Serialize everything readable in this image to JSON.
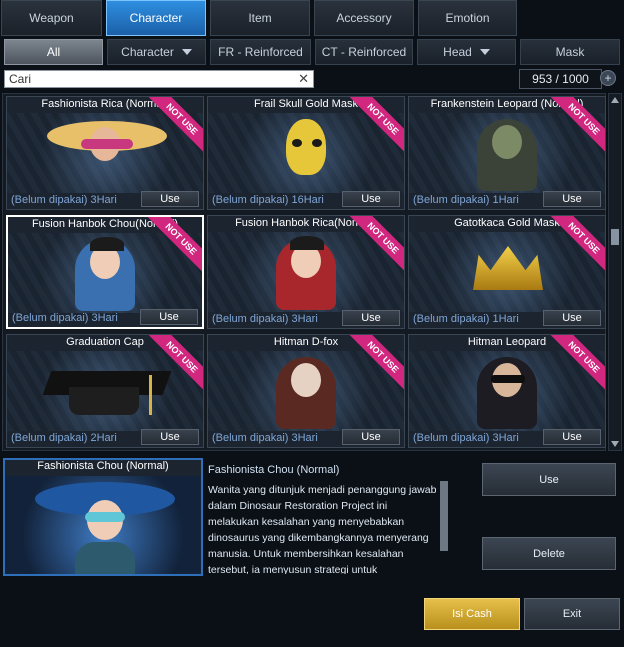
{
  "tabs": [
    {
      "label": "Weapon",
      "active": false
    },
    {
      "label": "Character",
      "active": true
    },
    {
      "label": "Item",
      "active": false
    },
    {
      "label": "Accessory",
      "active": false
    },
    {
      "label": "Emotion",
      "active": false
    }
  ],
  "filters": [
    {
      "label": "All",
      "active": true
    },
    {
      "label": "Character",
      "dropdown": true
    },
    {
      "label": "FR - Reinforced"
    },
    {
      "label": "CT - Reinforced"
    },
    {
      "label": "Head",
      "dropdown": true
    },
    {
      "label": "Mask"
    }
  ],
  "search": {
    "value": "Cari"
  },
  "counter": {
    "text": "953 / 1000"
  },
  "items": [
    {
      "name": "Fashionista Rica (Normal)",
      "duration": "(Belum dipakai) 3Hari",
      "use_label": "Use",
      "badge": "NOT USE"
    },
    {
      "name": "Frail Skull Gold Mask",
      "duration": "(Belum dipakai) 16Hari",
      "use_label": "Use",
      "badge": "NOT USE"
    },
    {
      "name": "Frankenstein Leopard (Normal)",
      "duration": "(Belum dipakai) 1Hari",
      "use_label": "Use",
      "badge": "NOT USE"
    },
    {
      "name": "Fusion Hanbok Chou(Normal)",
      "duration": "(Belum dipakai) 3Hari",
      "use_label": "Use",
      "badge": "NOT USE",
      "selected": true
    },
    {
      "name": "Fusion Hanbok Rica(Normal)",
      "duration": "(Belum dipakai) 3Hari",
      "use_label": "Use",
      "badge": "NOT USE"
    },
    {
      "name": "Gatotkaca Gold Mask",
      "duration": "(Belum dipakai) 1Hari",
      "use_label": "Use",
      "badge": "NOT USE"
    },
    {
      "name": "Graduation Cap",
      "duration": "(Belum dipakai) 2Hari",
      "use_label": "Use",
      "badge": "NOT USE"
    },
    {
      "name": "Hitman D-fox",
      "duration": "(Belum dipakai) 3Hari",
      "use_label": "Use",
      "badge": "NOT USE"
    },
    {
      "name": "Hitman Leopard",
      "duration": "(Belum dipakai) 3Hari",
      "use_label": "Use",
      "badge": "NOT USE"
    }
  ],
  "detail": {
    "card_name": "Fashionista Chou (Normal)",
    "title": "Fashionista Chou (Normal)",
    "description": "Wanita yang ditunjuk menjadi penanggung jawab dalam Dinosaur Restoration Project ini melakukan kesalahan yang menyebabkan dinosaurus yang dikembangkannya menyerang manusia. Untuk membersihkan kesalahan tersebut, ia menyusun strategi untuk melenyapkan para dinosaur",
    "use_label": "Use",
    "delete_label": "Delete"
  },
  "footer": {
    "cash_label": "Isi Cash",
    "exit_label": "Exit"
  },
  "colors": {
    "accent": "#2f8fe0",
    "badge": "#d2277f",
    "cash": "#d8ab2a",
    "duration": "#7fa6d6"
  }
}
